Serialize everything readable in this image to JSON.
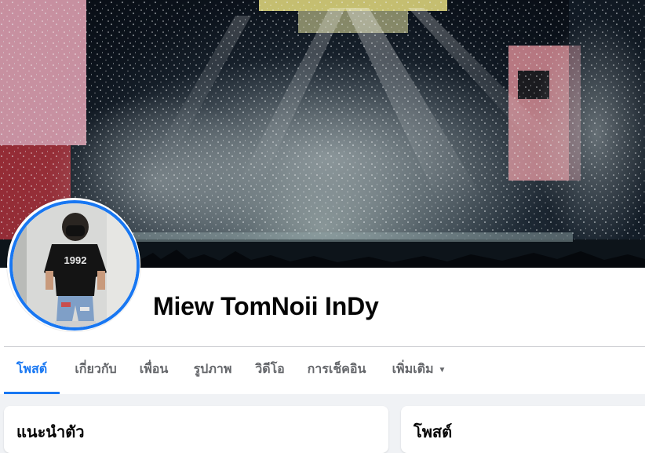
{
  "profile": {
    "name": "Miew TomNoii InDy"
  },
  "avatar": {
    "shirt_text": "1992",
    "ring_color": "#1877f2"
  },
  "tabs": [
    {
      "label": "โพสต์",
      "active": true
    },
    {
      "label": "เกี่ยวกับ",
      "active": false
    },
    {
      "label": "เพื่อน",
      "active": false
    },
    {
      "label": "รูปภาพ",
      "active": false
    },
    {
      "label": "วิดีโอ",
      "active": false
    },
    {
      "label": "การเช็คอิน",
      "active": false
    },
    {
      "label": "เพิ่มเติม",
      "active": false,
      "dropdown": true
    }
  ],
  "cards": {
    "intro_title": "แนะนำตัว",
    "posts_title": "โพสต์"
  },
  "colors": {
    "accent": "#1877f2",
    "page_bg": "#f0f2f5",
    "muted_text": "#65676b"
  }
}
